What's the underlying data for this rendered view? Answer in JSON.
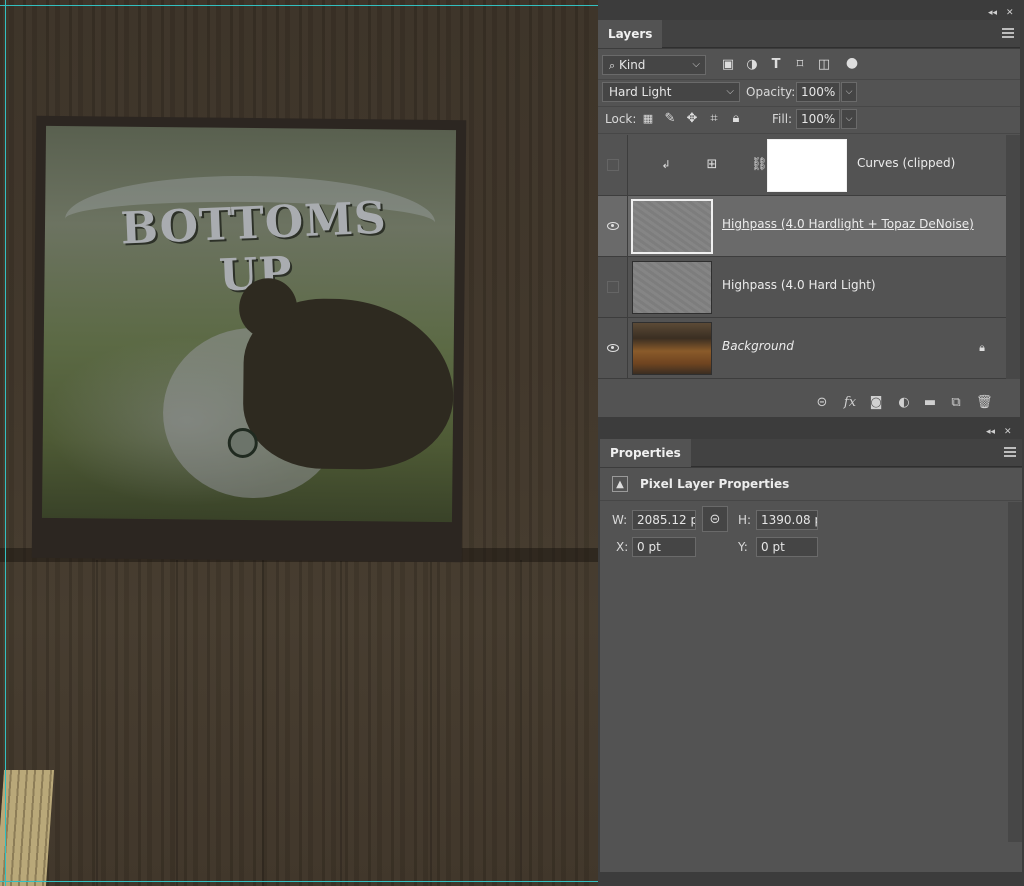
{
  "canvas": {
    "poster_text": "BOTTOMS UP"
  },
  "layers_panel": {
    "tab_label": "Layers",
    "filter_kind": "Kind",
    "filter_icons": [
      "image-filter-icon",
      "adjustment-filter-icon",
      "type-filter-icon",
      "shape-filter-icon",
      "smart-object-filter-icon",
      "filter-toggle-icon"
    ],
    "blend_mode": "Hard Light",
    "opacity_label": "Opacity:",
    "opacity_value": "100%",
    "lock_label": "Lock:",
    "lock_icons": [
      "lock-transparent-pixels-icon",
      "lock-image-pixels-icon",
      "lock-position-icon",
      "lock-artboard-icon",
      "lock-all-icon"
    ],
    "fill_label": "Fill:",
    "fill_value": "100%",
    "layers": [
      {
        "name": "Curves (clipped)",
        "visible": false,
        "selected": false,
        "type": "adjustment"
      },
      {
        "name": "Highpass (4.0 Hardlight + Topaz DeNoise)",
        "visible": true,
        "selected": true,
        "type": "pixel"
      },
      {
        "name": "Highpass (4.0 Hard Light)",
        "visible": false,
        "selected": false,
        "type": "pixel"
      },
      {
        "name": "Background",
        "visible": true,
        "selected": false,
        "type": "background",
        "locked": true
      }
    ],
    "footer_icons": [
      "link-layers-icon",
      "fx-icon",
      "add-mask-icon",
      "new-adjustment-layer-icon",
      "new-group-icon",
      "new-layer-icon",
      "delete-layer-icon"
    ]
  },
  "properties_panel": {
    "tab_label": "Properties",
    "section_title": "Pixel Layer Properties",
    "w_label": "W:",
    "w_value": "2085.12 p",
    "h_label": "H:",
    "h_value": "1390.08 p",
    "x_label": "X:",
    "x_value": "0 pt",
    "y_label": "Y:",
    "y_value": "0 pt"
  },
  "colors": {
    "panel_bg": "#535353",
    "dock_bg": "#3c3c3c",
    "selected_row": "#6a6a6a",
    "guide": "#33c0c0"
  }
}
